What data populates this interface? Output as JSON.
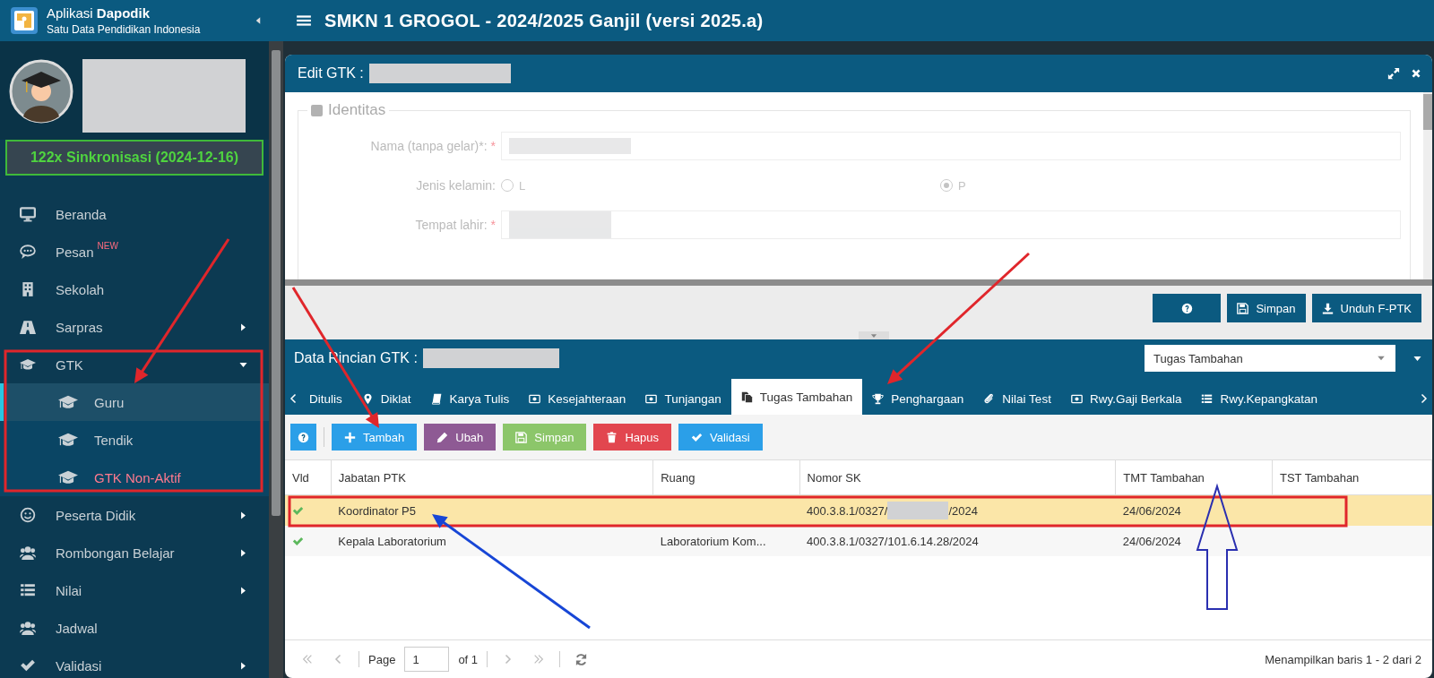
{
  "header": {
    "app_name": "Aplikasi **Dapodik**",
    "subtitle": "Satu Data Pendidikan Indonesia",
    "page_title": "SMKN 1 GROGOL - 2024/2025 Ganjil (versi 2025.a)"
  },
  "sidebar": {
    "sync_status": "122x Sinkronisasi (2024-12-16)",
    "items": [
      {
        "label": "Beranda"
      },
      {
        "label": "Pesan",
        "badge": "NEW"
      },
      {
        "label": "Sekolah"
      },
      {
        "label": "Sarpras",
        "expanded": false
      },
      {
        "label": "GTK",
        "expanded": true,
        "children": [
          {
            "label": "Guru",
            "selected": true,
            "inactive": false
          },
          {
            "label": "Tendik",
            "selected": false,
            "inactive": false
          },
          {
            "label": "GTK Non-Aktif",
            "selected": false,
            "inactive": true
          }
        ]
      },
      {
        "label": "Peserta Didik",
        "expanded": false
      },
      {
        "label": "Rombongan Belajar",
        "expanded": false
      },
      {
        "label": "Nilai",
        "expanded": false
      },
      {
        "label": "Jadwal"
      },
      {
        "label": "Validasi",
        "expanded": false
      }
    ]
  },
  "edit_panel": {
    "title": "Edit GTK :",
    "legend": "Identitas",
    "fields": [
      {
        "kind": "text",
        "label": "Nama (tanpa gelar)*:",
        "required_mark": "*"
      },
      {
        "kind": "radio",
        "label": "Jenis kelamin:",
        "options": [
          {
            "label": "L",
            "selected": false
          },
          {
            "label": "P",
            "selected": true
          }
        ]
      },
      {
        "kind": "text",
        "label": "Tempat lahir:",
        "required_mark": "*"
      }
    ],
    "buttons": [
      {
        "kind": "help"
      },
      {
        "kind": "save",
        "label": "Simpan"
      },
      {
        "kind": "download",
        "label": "Unduh F-PTK"
      }
    ]
  },
  "detail_panel": {
    "title": "Data Rincian GTK :",
    "dropdown": "Tugas Tambahan",
    "tabs": [
      {
        "label": "Ditulis",
        "selected": false
      },
      {
        "label": "Diklat",
        "selected": false
      },
      {
        "label": "Karya Tulis",
        "selected": false
      },
      {
        "label": "Kesejahteraan",
        "selected": false
      },
      {
        "label": "Tunjangan",
        "selected": false
      },
      {
        "label": "Tugas Tambahan",
        "selected": true
      },
      {
        "label": "Penghargaan",
        "selected": false
      },
      {
        "label": "Nilai Test",
        "selected": false
      },
      {
        "label": "Rwy.Gaji Berkala",
        "selected": false
      },
      {
        "label": "Rwy.Kepangkatan",
        "selected": false
      }
    ],
    "toolbar": [
      {
        "kind": "help",
        "color": "#2b9fe8"
      },
      {
        "kind": "add",
        "label": "Tambah",
        "color": "#2b9fe8"
      },
      {
        "kind": "edit",
        "label": "Ubah",
        "color": "#8e5a94"
      },
      {
        "kind": "save",
        "label": "Simpan",
        "color": "#8cc66a"
      },
      {
        "kind": "delete",
        "label": "Hapus",
        "color": "#e2464f"
      },
      {
        "kind": "validate",
        "label": "Validasi",
        "color": "#2b9fe8"
      }
    ],
    "table": {
      "columns": [
        "Vld",
        "Jabatan PTK",
        "Ruang",
        "Nomor SK",
        "TMT Tambahan",
        "TST Tambahan"
      ],
      "rows": [
        {
          "selected": true,
          "validated": true,
          "jabatan": "Koordinator P5",
          "ruang": "",
          "nomor_sk": [
            "400.3.8.1/0327/",
            "/2024"
          ],
          "tmt": "24/06/2024"
        },
        {
          "selected": false,
          "validated": true,
          "jabatan": "Kepala Laboratorium",
          "ruang": "Laboratorium Kom...",
          "nomor_sk": [
            "400.3.8.1/0327/101.6.14.28/2024"
          ],
          "tmt": "24/06/2024"
        }
      ]
    },
    "pager": {
      "page_label": "Page",
      "page": "1",
      "of": "of 1",
      "status": "Menampilkan baris 1 - 2 dari 2"
    }
  }
}
